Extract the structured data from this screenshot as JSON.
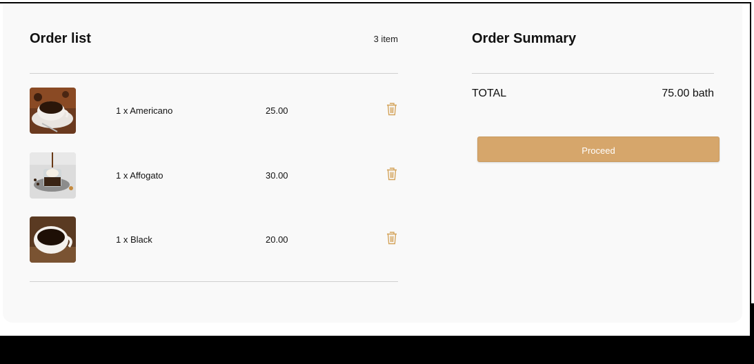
{
  "order_list": {
    "title": "Order list",
    "count": "3 item",
    "items": [
      {
        "label": "1 x Americano",
        "price": "25.00",
        "image": "americano-coffee-image"
      },
      {
        "label": "1 x Affogato",
        "price": "30.00",
        "image": "affogato-coffee-image"
      },
      {
        "label": "1 x Black",
        "price": "20.00",
        "image": "black-coffee-image"
      }
    ]
  },
  "summary": {
    "title": "Order Summary",
    "total_label": "TOTAL",
    "total_value": "75.00 bath",
    "proceed_label": "Proceed"
  },
  "colors": {
    "accent": "#d6a66b",
    "trash": "#d4a45c",
    "card_bg": "#f9f9f9",
    "divider": "#cfcfcf"
  }
}
